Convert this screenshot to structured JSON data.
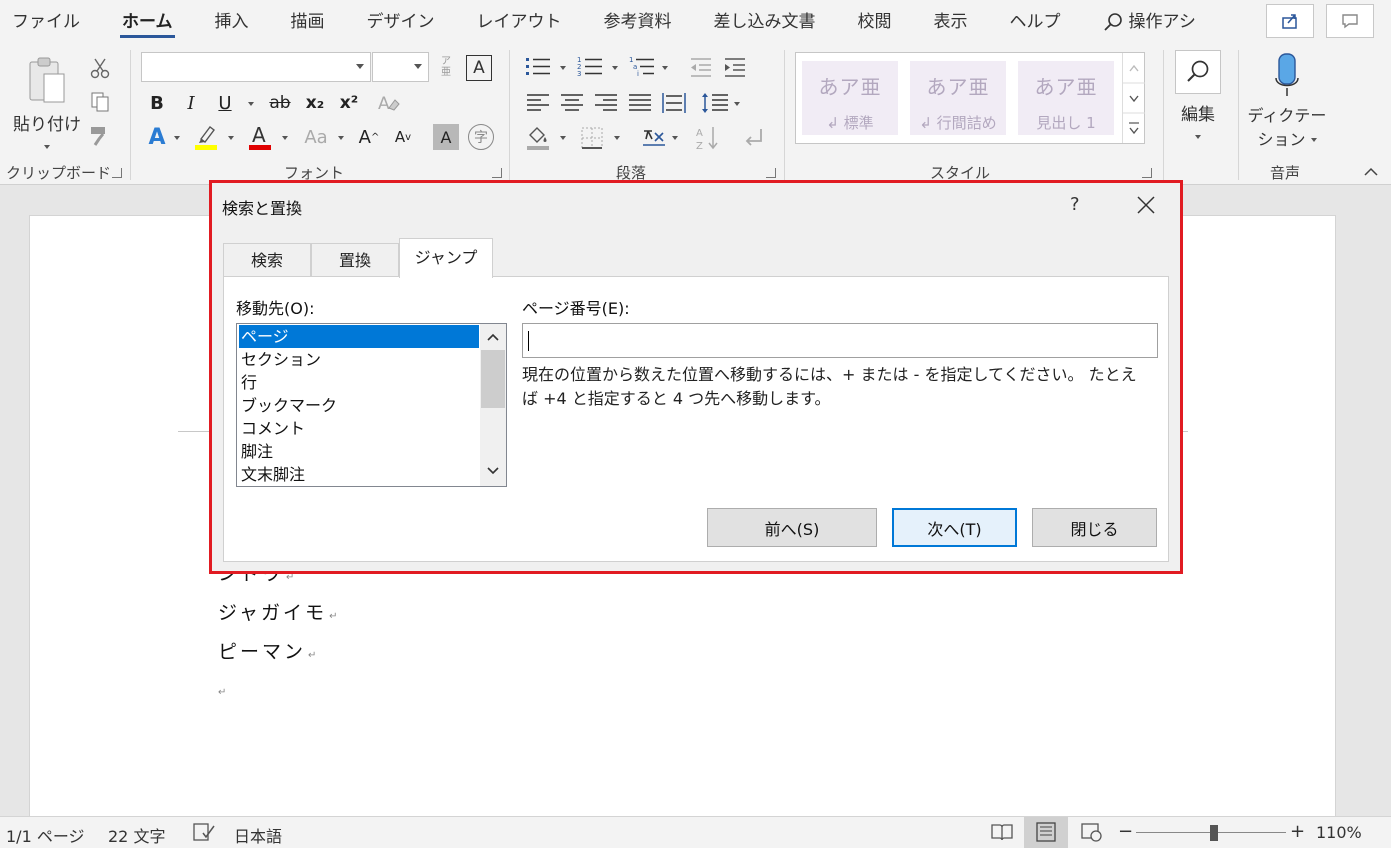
{
  "ribbon": {
    "tabs": [
      "ファイル",
      "ホーム",
      "挿入",
      "描画",
      "デザイン",
      "レイアウト",
      "参考資料",
      "差し込み文書",
      "校閲",
      "表示",
      "ヘルプ"
    ],
    "active_tab": "ホーム",
    "tell_me": "操作アシ",
    "groups": {
      "clipboard": {
        "label": "クリップボード",
        "paste": "貼り付け"
      },
      "font": {
        "label": "フォント",
        "font_name": "",
        "font_size": ""
      },
      "paragraph": {
        "label": "段落"
      },
      "styles": {
        "label": "スタイル",
        "items": [
          {
            "sample": "あア亜",
            "name": "↲ 標準"
          },
          {
            "sample": "あア亜",
            "name": "↲ 行間詰め"
          },
          {
            "sample": "あア亜",
            "name": "見出し 1"
          }
        ]
      },
      "editing": {
        "label": "編集"
      },
      "voice": {
        "label": "音声",
        "dictate_line1": "ディクテー",
        "dictate_line2": "ション"
      }
    },
    "font_buttons": {
      "bold": "B",
      "italic": "I",
      "underline": "U",
      "strike": "ab",
      "subscript": "x₂",
      "superscript": "x²",
      "font_color": "A",
      "highlight_color": "#ffff00",
      "font_color_bar": "#e00000",
      "text_effects": "A",
      "case": "Aa",
      "grow": "A",
      "shrink": "A",
      "char_shade": "A",
      "enclose": "字"
    }
  },
  "document": {
    "lines": [
      "ジャガイモ",
      "ピーマン"
    ],
    "partial_line": "ンドウ"
  },
  "dialog": {
    "title": "検索と置換",
    "help": "?",
    "tabs": [
      "検索",
      "置換",
      "ジャンプ"
    ],
    "active_tab": "ジャンプ",
    "goto_label": "移動先(O):",
    "goto_items": [
      "ページ",
      "セクション",
      "行",
      "ブックマーク",
      "コメント",
      "脚注",
      "文末脚注"
    ],
    "goto_selected": "ページ",
    "page_label": "ページ番号(E):",
    "page_value": "",
    "hint": "現在の位置から数えた位置へ移動するには、+ または - を指定してください。 たとえば +4 と指定すると 4 つ先へ移動します。",
    "buttons": {
      "prev": "前へ(S)",
      "next": "次へ(T)",
      "close": "閉じる"
    },
    "accent": "#0078d7",
    "border": "#e11b22"
  },
  "status": {
    "page": "1/1 ページ",
    "words": "22 文字",
    "language": "日本語",
    "zoom": "110%",
    "zoom_percent": 110
  }
}
